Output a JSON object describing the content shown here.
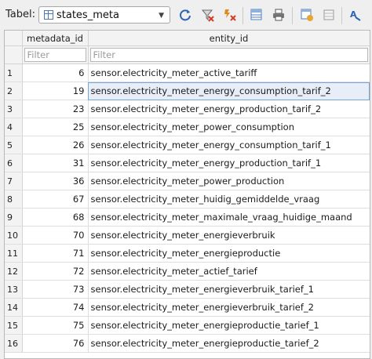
{
  "toolbar": {
    "table_label": "Tabel:",
    "table_select_value": "states_meta",
    "icons": [
      "refresh-icon",
      "clear-filters-icon",
      "save-filters-icon",
      "insert-record-icon",
      "print-icon",
      "new-record-icon",
      "delete-record-icon",
      "find-icon"
    ]
  },
  "grid": {
    "headers": [
      "metadata_id",
      "entity_id"
    ],
    "filter_placeholders": [
      "Filter",
      "Filter"
    ],
    "rows": [
      {
        "n": "1",
        "metadata_id": "6",
        "entity_id": "sensor.electricity_meter_active_tariff"
      },
      {
        "n": "2",
        "metadata_id": "19",
        "entity_id": "sensor.electricity_meter_energy_consumption_tarif_2"
      },
      {
        "n": "3",
        "metadata_id": "23",
        "entity_id": "sensor.electricity_meter_energy_production_tarif_2"
      },
      {
        "n": "4",
        "metadata_id": "25",
        "entity_id": "sensor.electricity_meter_power_consumption"
      },
      {
        "n": "5",
        "metadata_id": "26",
        "entity_id": "sensor.electricity_meter_energy_consumption_tarif_1"
      },
      {
        "n": "6",
        "metadata_id": "31",
        "entity_id": "sensor.electricity_meter_energy_production_tarif_1"
      },
      {
        "n": "7",
        "metadata_id": "36",
        "entity_id": "sensor.electricity_meter_power_production"
      },
      {
        "n": "8",
        "metadata_id": "67",
        "entity_id": "sensor.electricity_meter_huidig_gemiddelde_vraag"
      },
      {
        "n": "9",
        "metadata_id": "68",
        "entity_id": "sensor.electricity_meter_maximale_vraag_huidige_maand"
      },
      {
        "n": "10",
        "metadata_id": "70",
        "entity_id": "sensor.electricity_meter_energieverbruik"
      },
      {
        "n": "11",
        "metadata_id": "71",
        "entity_id": "sensor.electricity_meter_energieproductie"
      },
      {
        "n": "12",
        "metadata_id": "72",
        "entity_id": "sensor.electricity_meter_actief_tarief"
      },
      {
        "n": "13",
        "metadata_id": "73",
        "entity_id": "sensor.electricity_meter_energieverbruik_tarief_1"
      },
      {
        "n": "14",
        "metadata_id": "74",
        "entity_id": "sensor.electricity_meter_energieverbruik_tarief_2"
      },
      {
        "n": "15",
        "metadata_id": "75",
        "entity_id": "sensor.electricity_meter_energieproductie_tarief_1"
      },
      {
        "n": "16",
        "metadata_id": "76",
        "entity_id": "sensor.electricity_meter_energieproductie_tarief_2"
      }
    ],
    "selected_row": "2"
  }
}
